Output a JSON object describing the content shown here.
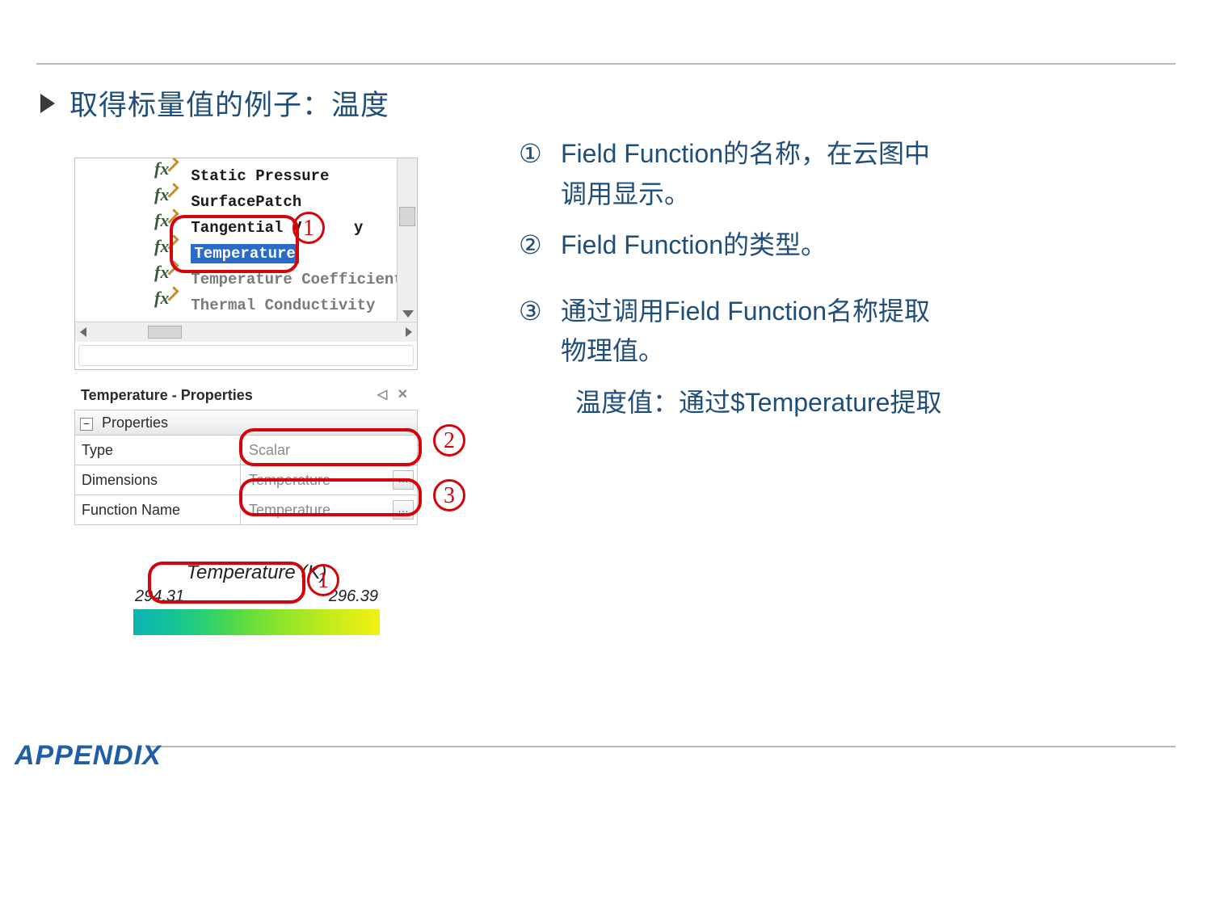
{
  "heading": "取得标量值的例子：温度",
  "tree": {
    "items": [
      {
        "label": "Static Pressure",
        "selected": false,
        "readonly": false
      },
      {
        "label": "SurfacePatch",
        "selected": false,
        "readonly": false
      },
      {
        "label_pre": "Tangential V",
        "label_post": "y",
        "selected": false,
        "readonly": false,
        "split": true
      },
      {
        "label": "Temperature",
        "selected": true,
        "readonly": false
      },
      {
        "label": "Temperature Coefficient",
        "selected": false,
        "readonly": true
      },
      {
        "label": "Thermal Conductivity",
        "selected": false,
        "readonly": true
      }
    ]
  },
  "props": {
    "title": "Temperature - Properties",
    "section": "Properties",
    "rows": [
      {
        "k": "Type",
        "v": "Scalar",
        "dots": false
      },
      {
        "k": "Dimensions",
        "v": "Temperature",
        "dots": true
      },
      {
        "k": "Function Name",
        "v": "Temperature",
        "dots": true
      }
    ]
  },
  "legend": {
    "title": "Temperature (K)",
    "min": "294.31",
    "max": "296.39"
  },
  "notes": {
    "n1a": "Field Function的名称，在云图中",
    "n1b": "调用显示。",
    "n2": "Field Function的类型。",
    "n3a": "通过调用Field Function名称提取",
    "n3b": "物理值。",
    "sub": "温度值：通过$Temperature提取",
    "mark1": "①",
    "mark2": "②",
    "mark3": "③"
  },
  "circles": {
    "c1": "1",
    "c2": "2",
    "c3": "3"
  },
  "footer": "APPENDIX"
}
